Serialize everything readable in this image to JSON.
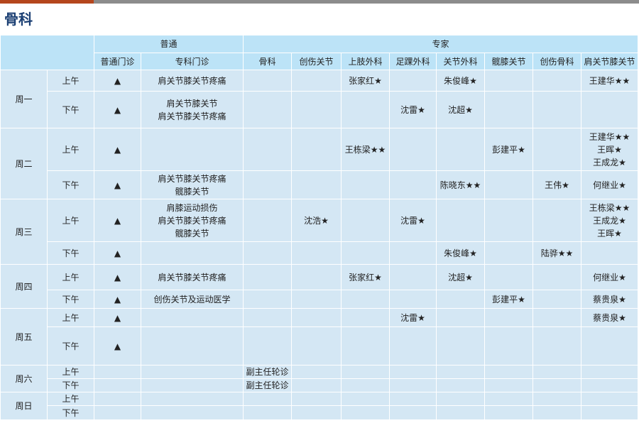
{
  "title": "骨科",
  "colors": {
    "accent": "#b5461d",
    "title": "#1b3f73",
    "header_bg": "#bce3f7",
    "cell_bg": "#d4e7f4"
  },
  "header": {
    "group_general": "普通",
    "group_expert": "专家",
    "columns": [
      "普通门诊",
      "专科门诊",
      "骨科",
      "创伤关节",
      "上肢外科",
      "足踝外科",
      "关节外科",
      "髋膝关节",
      "创伤骨科",
      "肩关节膝关节"
    ]
  },
  "schedule": [
    {
      "day": "周一",
      "sessions": [
        {
          "period": "上午",
          "cells": [
            "▲",
            "肩关节膝关节疼痛",
            "",
            "",
            "张家红★",
            "",
            "朱俊峰★",
            "",
            "",
            "王建华★★"
          ]
        },
        {
          "period": "下午",
          "cells": [
            "▲",
            "肩关节膝关节\n肩关节膝关节疼痛",
            "",
            "",
            "",
            "沈雷★",
            "沈超★",
            "",
            "",
            ""
          ]
        }
      ]
    },
    {
      "day": "周二",
      "sessions": [
        {
          "period": "上午",
          "cells": [
            "▲",
            "",
            "",
            "",
            "王栋梁★★",
            "",
            "",
            "彭建平★",
            "",
            "王建华★★\n王晖★\n王成龙★"
          ]
        },
        {
          "period": "下午",
          "cells": [
            "▲",
            "肩关节膝关节疼痛\n髋膝关节",
            "",
            "",
            "",
            "",
            "陈晓东★★",
            "",
            "王伟★",
            "何继业★"
          ]
        }
      ]
    },
    {
      "day": "周三",
      "sessions": [
        {
          "period": "上午",
          "cells": [
            "▲",
            "肩膝运动损伤\n肩关节膝关节疼痛\n髋膝关节",
            "",
            "沈浩★",
            "",
            "沈雷★",
            "",
            "",
            "",
            "王栋梁★★\n王成龙★\n王晖★"
          ]
        },
        {
          "period": "下午",
          "cells": [
            "▲",
            "",
            "",
            "",
            "",
            "",
            "朱俊峰★",
            "",
            "陆骅★★",
            ""
          ]
        }
      ]
    },
    {
      "day": "周四",
      "sessions": [
        {
          "period": "上午",
          "cells": [
            "▲",
            "肩关节膝关节疼痛",
            "",
            "",
            "张家红★",
            "",
            "沈超★",
            "",
            "",
            "何继业★"
          ]
        },
        {
          "period": "下午",
          "cells": [
            "▲",
            "创伤关节及运动医学",
            "",
            "",
            "",
            "",
            "",
            "彭建平★",
            "",
            "蔡贵泉★"
          ]
        }
      ]
    },
    {
      "day": "周五",
      "sessions": [
        {
          "period": "上午",
          "cells": [
            "▲",
            "",
            "",
            "",
            "",
            "沈雷★",
            "",
            "",
            "",
            "蔡贵泉★"
          ]
        },
        {
          "period": "下午",
          "cells": [
            "▲",
            "",
            "",
            "",
            "",
            "",
            "",
            "",
            "",
            ""
          ]
        }
      ]
    },
    {
      "day": "周六",
      "sessions": [
        {
          "period": "上午",
          "cells": [
            "",
            "",
            "副主任轮诊",
            "",
            "",
            "",
            "",
            "",
            "",
            ""
          ]
        },
        {
          "period": "下午",
          "cells": [
            "",
            "",
            "副主任轮诊",
            "",
            "",
            "",
            "",
            "",
            "",
            ""
          ]
        }
      ]
    },
    {
      "day": "周日",
      "sessions": [
        {
          "period": "上午",
          "cells": [
            "",
            "",
            "",
            "",
            "",
            "",
            "",
            "",
            "",
            ""
          ]
        },
        {
          "period": "下午",
          "cells": [
            "",
            "",
            "",
            "",
            "",
            "",
            "",
            "",
            "",
            ""
          ]
        }
      ]
    }
  ]
}
